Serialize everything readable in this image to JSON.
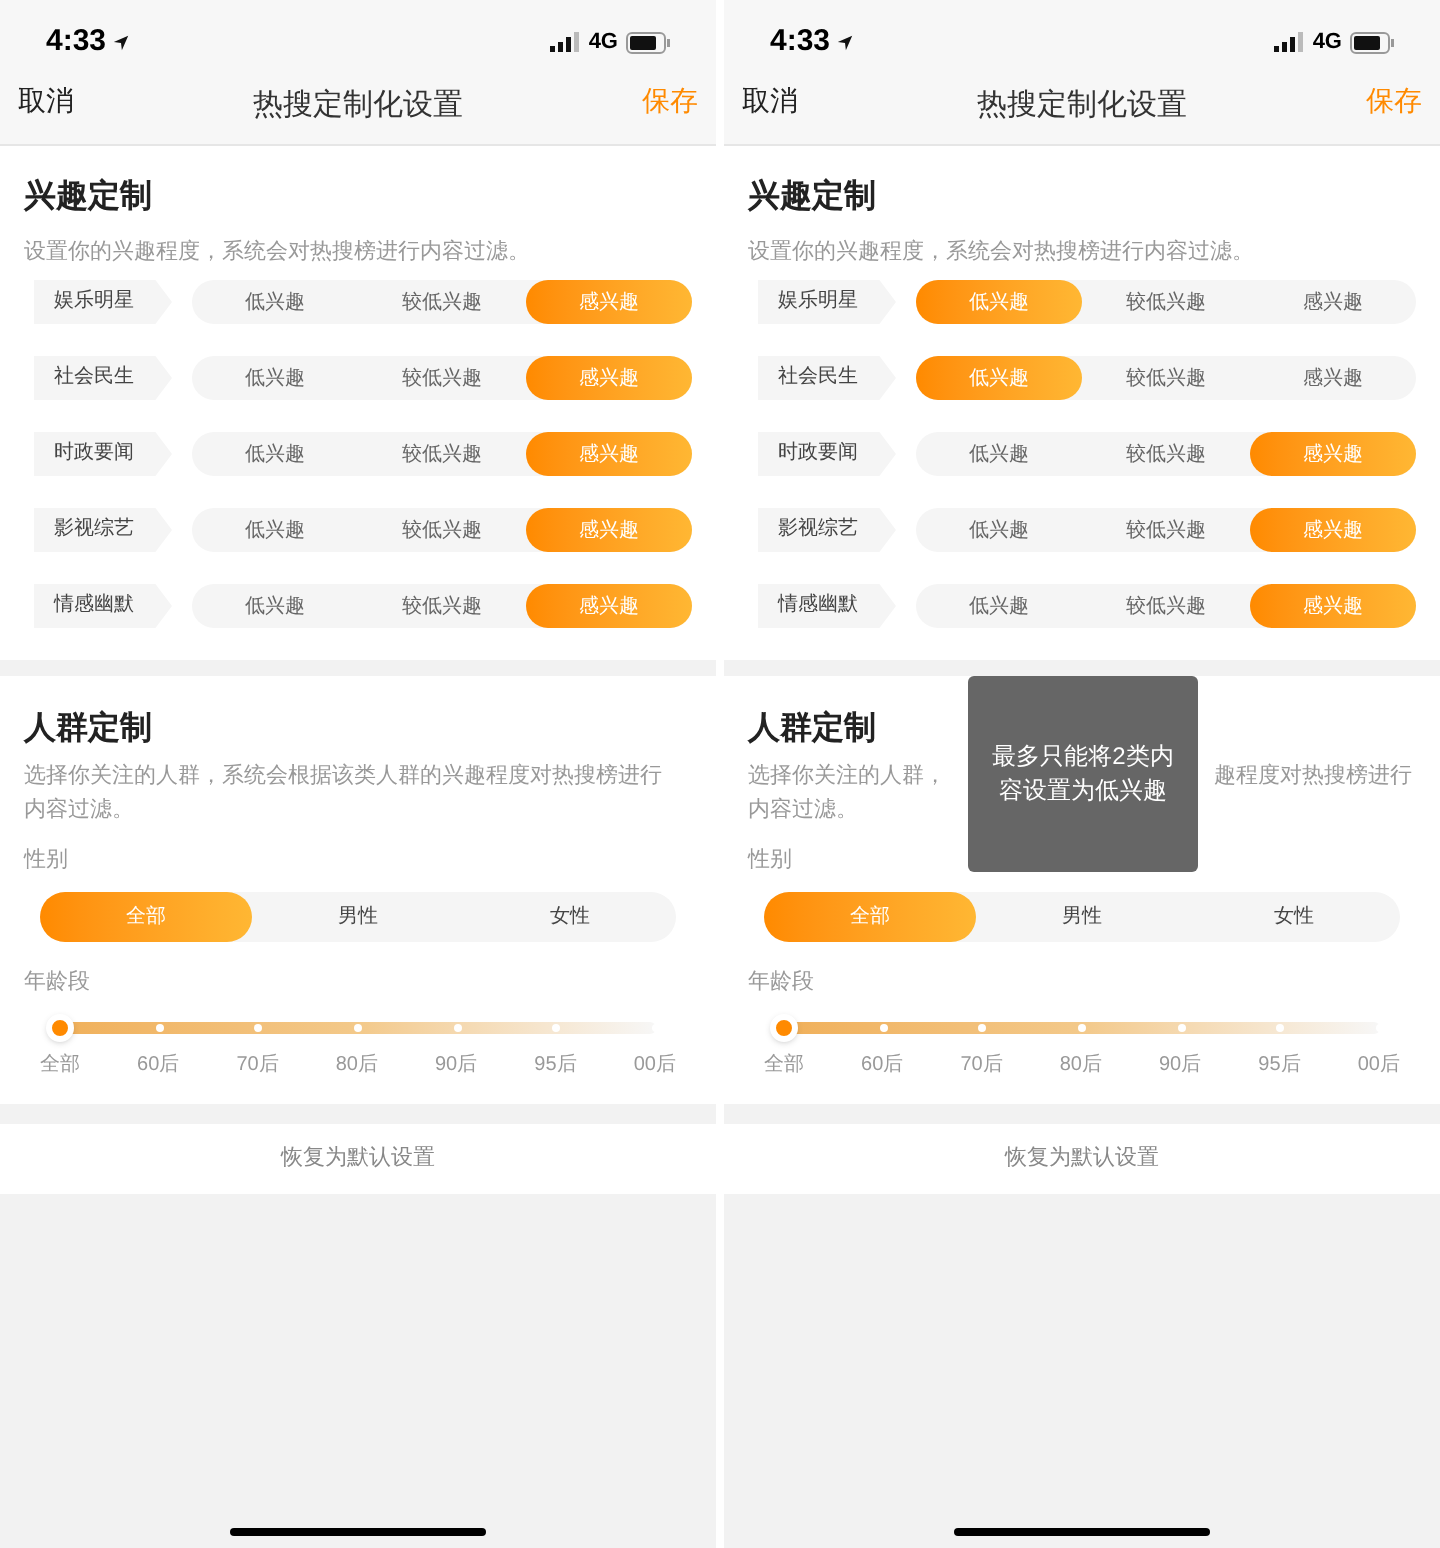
{
  "screens": [
    {
      "status_bar": {
        "time": "4:33",
        "network": "4G"
      },
      "nav": {
        "cancel": "取消",
        "title": "热搜定制化设置",
        "save": "保存"
      },
      "interest": {
        "title": "兴趣定制",
        "description": "设置你的兴趣程度，系统会对热搜榜进行内容过滤。",
        "rows": [
          {
            "label": "娱乐明星",
            "options": [
              {
                "label": "低兴趣",
                "selected": false
              },
              {
                "label": "较低兴趣",
                "selected": false
              },
              {
                "label": "感兴趣",
                "selected": true
              }
            ]
          },
          {
            "label": "社会民生",
            "options": [
              {
                "label": "低兴趣",
                "selected": false
              },
              {
                "label": "较低兴趣",
                "selected": false
              },
              {
                "label": "感兴趣",
                "selected": true
              }
            ]
          },
          {
            "label": "时政要闻",
            "options": [
              {
                "label": "低兴趣",
                "selected": false
              },
              {
                "label": "较低兴趣",
                "selected": false
              },
              {
                "label": "感兴趣",
                "selected": true
              }
            ]
          },
          {
            "label": "影视综艺",
            "options": [
              {
                "label": "低兴趣",
                "selected": false
              },
              {
                "label": "较低兴趣",
                "selected": false
              },
              {
                "label": "感兴趣",
                "selected": true
              }
            ]
          },
          {
            "label": "情感幽默",
            "options": [
              {
                "label": "低兴趣",
                "selected": false
              },
              {
                "label": "较低兴趣",
                "selected": false
              },
              {
                "label": "感兴趣",
                "selected": true
              }
            ]
          }
        ]
      },
      "crowd": {
        "title": "人群定制",
        "description": "选择你关注的人群，系统会根据该类人群的兴趣程度对热搜榜进行内容过滤。",
        "gender_label": "性别",
        "genders": [
          {
            "label": "全部",
            "selected": true
          },
          {
            "label": "男性",
            "selected": false
          },
          {
            "label": "女性",
            "selected": false
          }
        ],
        "age_label": "年龄段",
        "age_slider": {
          "level": 0
        },
        "ages": [
          "全部",
          "60后",
          "70后",
          "80后",
          "90后",
          "95后",
          "00后"
        ]
      },
      "reset": "恢复为默认设置"
    },
    {
      "status_bar": {
        "time": "4:33",
        "network": "4G"
      },
      "nav": {
        "cancel": "取消",
        "title": "热搜定制化设置",
        "save": "保存"
      },
      "interest": {
        "title": "兴趣定制",
        "description": "设置你的兴趣程度，系统会对热搜榜进行内容过滤。",
        "rows": [
          {
            "label": "娱乐明星",
            "options": [
              {
                "label": "低兴趣",
                "selected": true
              },
              {
                "label": "较低兴趣",
                "selected": false
              },
              {
                "label": "感兴趣",
                "selected": false
              }
            ]
          },
          {
            "label": "社会民生",
            "options": [
              {
                "label": "低兴趣",
                "selected": true
              },
              {
                "label": "较低兴趣",
                "selected": false
              },
              {
                "label": "感兴趣",
                "selected": false
              }
            ]
          },
          {
            "label": "时政要闻",
            "options": [
              {
                "label": "低兴趣",
                "selected": false
              },
              {
                "label": "较低兴趣",
                "selected": false
              },
              {
                "label": "感兴趣",
                "selected": true
              }
            ]
          },
          {
            "label": "影视综艺",
            "options": [
              {
                "label": "低兴趣",
                "selected": false
              },
              {
                "label": "较低兴趣",
                "selected": false
              },
              {
                "label": "感兴趣",
                "selected": true
              }
            ]
          },
          {
            "label": "情感幽默",
            "options": [
              {
                "label": "低兴趣",
                "selected": false
              },
              {
                "label": "较低兴趣",
                "selected": false
              },
              {
                "label": "感兴趣",
                "selected": true
              }
            ]
          }
        ]
      },
      "crowd": {
        "title": "人群定制",
        "description_visible": {
          "line_1_left": "选择你关注的人群，",
          "line_1_right": "趣程度对热搜榜进行",
          "line_2": "内容过滤。"
        },
        "gender_label": "性别",
        "genders": [
          {
            "label": "全部",
            "selected": true
          },
          {
            "label": "男性",
            "selected": false
          },
          {
            "label": "女性",
            "selected": false
          }
        ],
        "age_label": "年龄段",
        "age_slider": {
          "level": 0
        },
        "ages": [
          "全部",
          "60后",
          "70后",
          "80后",
          "90后",
          "95后",
          "00后"
        ]
      },
      "reset": "恢复为默认设置",
      "toast": "最多只能将2类内容设置为低兴趣"
    }
  ]
}
